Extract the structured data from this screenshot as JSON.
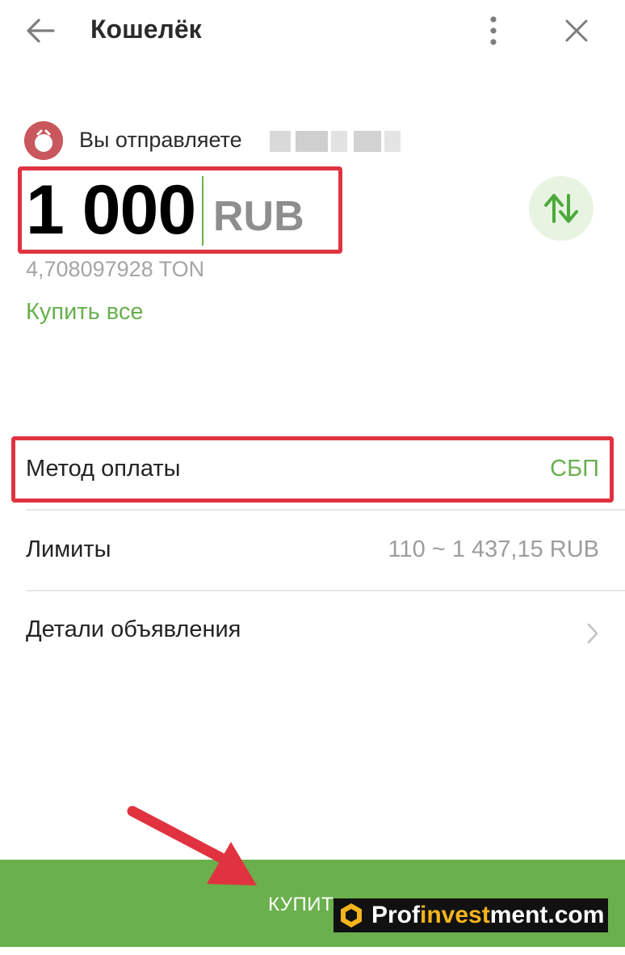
{
  "header": {
    "title": "Кошелёк"
  },
  "icons": {
    "back": "arrow-left-icon",
    "more": "more-vertical-icon",
    "close": "close-icon",
    "swap": "swap-vertical-icon",
    "chevron": "chevron-right-icon"
  },
  "recipient": {
    "label": "Вы отправляете"
  },
  "amount": {
    "value": "1 000",
    "currency": "RUB",
    "converted": "4,708097928 TON"
  },
  "buy_all_label": "Купить все",
  "rows": {
    "payment_method": {
      "label": "Метод оплаты",
      "value": "СБП"
    },
    "limits": {
      "label": "Лимиты",
      "value": "110 ~ 1 437,15 RUB"
    },
    "ad_details": {
      "label": "Детали объявления"
    }
  },
  "buy_button": {
    "label": "КУПИТ"
  },
  "watermark": {
    "part1": "Prof",
    "part2": "invest",
    "part3": "ment.com"
  },
  "colors": {
    "accent_green": "#6ab04c",
    "text_green": "#67b04f",
    "highlight_red": "#e0333f",
    "avatar": "#c9575d"
  }
}
